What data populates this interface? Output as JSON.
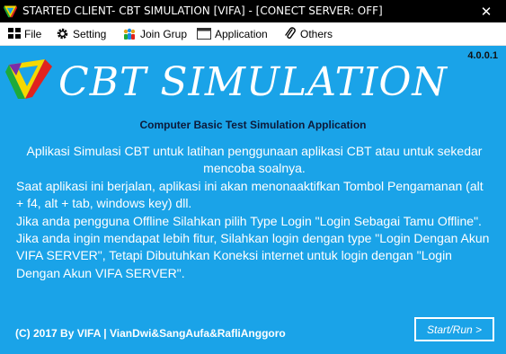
{
  "window": {
    "title": "STARTED CLIENT- CBT SIMULATION [VIFA] - [CONECT SERVER: OFF]",
    "close_glyph": "✕"
  },
  "menu": [
    {
      "label": "File",
      "icon": "grid-icon"
    },
    {
      "label": "Setting",
      "icon": "gear-icon"
    },
    {
      "label": "Join Grup",
      "icon": "users-icon"
    },
    {
      "label": "Application",
      "icon": "app-window-icon"
    },
    {
      "label": "Others",
      "icon": "paperclip-icon"
    }
  ],
  "main": {
    "version": "4.0.0.1",
    "app_title": "CBT SIMULATION",
    "subtitle": "Computer Basic Test Simulation Application",
    "description": [
      "Aplikasi Simulasi CBT untuk latihan penggunaan aplikasi CBT atau untuk sekedar mencoba soalnya.",
      "Saat aplikasi ini berjalan, aplikasi ini akan menonaaktifkan Tombol Pengamanan (alt + f4, alt + tab, windows key) dll.",
      " Jika anda pengguna Offline Silahkan pilih Type Login \"Login Sebagai Tamu Offline\". Jika anda ingin mendapat lebih fitur, Silahkan login dengan type \"Login Dengan Akun VIFA SERVER\", Tetapi Dibutuhkan Koneksi internet untuk login dengan \"Login Dengan Akun VIFA SERVER\"."
    ],
    "footer": "(C) 2017 By VIFA | VianDwi&SangAufa&RafliAnggoro",
    "start_label": "Start/Run >"
  },
  "colors": {
    "background": "#1AA3E8",
    "titlebar": "#000000",
    "menubar": "#FFFFFF"
  }
}
